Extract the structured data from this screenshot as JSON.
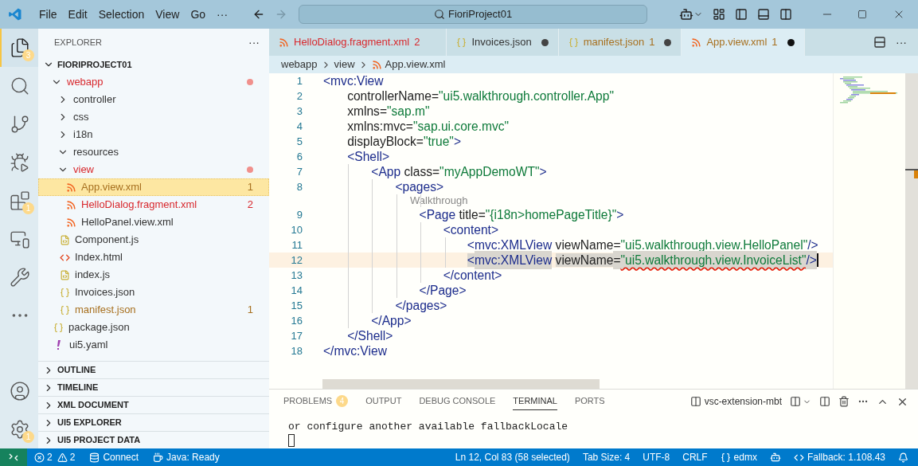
{
  "menu": [
    "File",
    "Edit",
    "Selection",
    "View",
    "Go",
    "···"
  ],
  "search": {
    "value": "FioriProject01"
  },
  "activity_bar": [
    {
      "kind": "explorer",
      "selected": true,
      "badge": "3"
    },
    {
      "kind": "search",
      "selected": false
    },
    {
      "kind": "source-control",
      "selected": false
    },
    {
      "kind": "run",
      "selected": false
    },
    {
      "kind": "extensions",
      "selected": false,
      "badge": "1"
    },
    {
      "kind": "remote",
      "selected": false
    },
    {
      "kind": "tools",
      "selected": false
    },
    {
      "kind": "more",
      "selected": false
    }
  ],
  "activity_bottom": [
    {
      "kind": "account"
    },
    {
      "kind": "settings",
      "badge": "1"
    }
  ],
  "explorer": {
    "title": "EXPLORER",
    "more": "···",
    "root": {
      "label": "FIORIPROJECT01",
      "expanded": true,
      "children": [
        {
          "label": "webapp",
          "kind": "folder",
          "expanded": true,
          "error": true,
          "warning": false,
          "selected": false,
          "children": [
            {
              "label": "controller",
              "kind": "folder",
              "expanded": false,
              "error": false,
              "warning": false,
              "selected": false
            },
            {
              "label": "css",
              "kind": "folder",
              "expanded": false,
              "error": false,
              "warning": false,
              "selected": false
            },
            {
              "label": "i18n",
              "kind": "folder",
              "expanded": false,
              "error": false,
              "warning": false,
              "selected": false
            },
            {
              "label": "resources",
              "kind": "folder",
              "expanded": true,
              "error": false,
              "warning": false,
              "selected": false
            },
            {
              "label": "view",
              "kind": "folder",
              "expanded": true,
              "error": true,
              "warning": false,
              "selected": false,
              "children": [
                {
                  "label": "App.view.xml",
                  "kind": "xml",
                  "error": false,
                  "warning": true,
                  "badge": "1",
                  "selected": true
                },
                {
                  "label": "HelloDialog.fragment.xml",
                  "kind": "xml",
                  "error": true,
                  "warning": false,
                  "badge": "2",
                  "selected": false
                },
                {
                  "label": "HelloPanel.view.xml",
                  "kind": "xml",
                  "error": false,
                  "warning": false,
                  "selected": false
                }
              ]
            },
            {
              "label": "Component.js",
              "kind": "js",
              "error": false,
              "warning": false,
              "selected": false
            },
            {
              "label": "Index.html",
              "kind": "html",
              "error": false,
              "warning": false,
              "selected": false
            },
            {
              "label": "index.js",
              "kind": "js",
              "error": false,
              "warning": false,
              "selected": false
            },
            {
              "label": "Invoices.json",
              "kind": "json",
              "error": false,
              "warning": false,
              "selected": false
            },
            {
              "label": "manifest.json",
              "kind": "json",
              "error": false,
              "warning": true,
              "badge": "1",
              "selected": false
            }
          ]
        },
        {
          "label": "package.json",
          "kind": "json",
          "error": false,
          "warning": false,
          "selected": false
        },
        {
          "label": "ui5.yaml",
          "kind": "yaml",
          "error": false,
          "warning": false,
          "selected": false
        }
      ]
    },
    "sections": [
      {
        "label": "OUTLINE",
        "expanded": false
      },
      {
        "label": "TIMELINE",
        "expanded": false
      },
      {
        "label": "XML DOCUMENT",
        "expanded": false
      },
      {
        "label": "UI5 EXPLORER",
        "expanded": false
      },
      {
        "label": "UI5 PROJECT DATA",
        "expanded": false
      }
    ]
  },
  "tabs": [
    {
      "label": "HelloDialog.fragment.xml",
      "kind": "xml",
      "error": true,
      "warning": false,
      "badge": "2",
      "modified": false,
      "selected": false
    },
    {
      "label": "Invoices.json",
      "kind": "json",
      "error": false,
      "warning": false,
      "modified": true,
      "selected": false
    },
    {
      "label": "manifest.json",
      "kind": "json",
      "error": false,
      "warning": true,
      "badge": "1",
      "modified": true,
      "selected": false
    },
    {
      "label": "App.view.xml",
      "kind": "xml",
      "error": false,
      "warning": true,
      "badge": "1",
      "modified": true,
      "selected": true
    }
  ],
  "tabs_more": "···",
  "breadcrumb": [
    {
      "label": "webapp",
      "kind": "folder"
    },
    {
      "label": "view",
      "kind": "folder"
    },
    {
      "label": "App.view.xml",
      "kind": "xml"
    }
  ],
  "code": [
    {
      "kind": "code",
      "number": "1",
      "tokens": [
        {
          "text": "<",
          "kind": "bracket"
        },
        {
          "text": "mvc:View",
          "kind": "tag"
        }
      ]
    },
    {
      "kind": "code",
      "number": "2",
      "tokens": [
        {
          "text": "    controllerName",
          "kind": "attr"
        },
        {
          "text": "=",
          "kind": "punct"
        },
        {
          "text": "\"ui5.walkthrough.controller.App\"",
          "kind": "string"
        }
      ]
    },
    {
      "kind": "code",
      "number": "3",
      "tokens": [
        {
          "text": "    xmlns",
          "kind": "attr"
        },
        {
          "text": "=",
          "kind": "punct"
        },
        {
          "text": "\"sap.m\"",
          "kind": "string"
        }
      ]
    },
    {
      "kind": "code",
      "number": "4",
      "tokens": [
        {
          "text": "    xmlns:mvc",
          "kind": "attr"
        },
        {
          "text": "=",
          "kind": "punct"
        },
        {
          "text": "\"sap.ui.core.mvc\"",
          "kind": "string"
        }
      ]
    },
    {
      "kind": "code",
      "number": "5",
      "tokens": [
        {
          "text": "    displayBlock",
          "kind": "attr"
        },
        {
          "text": "=",
          "kind": "punct"
        },
        {
          "text": "\"true\"",
          "kind": "string"
        },
        {
          "text": ">",
          "kind": "bracket"
        }
      ]
    },
    {
      "kind": "code",
      "number": "6",
      "tokens": [
        {
          "text": "    <",
          "kind": "bracket"
        },
        {
          "text": "Shell",
          "kind": "tag"
        },
        {
          "text": ">",
          "kind": "bracket"
        }
      ]
    },
    {
      "kind": "code",
      "number": "7",
      "tokens": [
        {
          "text": "        <",
          "kind": "bracket"
        },
        {
          "text": "App",
          "kind": "tag"
        },
        {
          "text": " class",
          "kind": "attr"
        },
        {
          "text": "=",
          "kind": "punct"
        },
        {
          "text": "\"myAppDemoWT\"",
          "kind": "string"
        },
        {
          "text": ">",
          "kind": "bracket"
        }
      ]
    },
    {
      "kind": "code",
      "number": "8",
      "tokens": [
        {
          "text": "            <",
          "kind": "bracket"
        },
        {
          "text": "pages",
          "kind": "tag"
        },
        {
          "text": ">",
          "kind": "bracket"
        }
      ]
    },
    {
      "kind": "codelens",
      "tokens": [
        {
          "text": "                Walkthrough",
          "kind": "hint"
        }
      ]
    },
    {
      "kind": "code",
      "number": "9",
      "tokens": [
        {
          "text": "                <",
          "kind": "bracket"
        },
        {
          "text": "Page",
          "kind": "tag"
        },
        {
          "text": " title",
          "kind": "attr"
        },
        {
          "text": "=",
          "kind": "punct"
        },
        {
          "text": "\"{i18n>homePageTitle}\"",
          "kind": "string"
        },
        {
          "text": ">",
          "kind": "bracket"
        }
      ]
    },
    {
      "kind": "code",
      "number": "10",
      "tokens": [
        {
          "text": "                    <",
          "kind": "bracket"
        },
        {
          "text": "content",
          "kind": "tag"
        },
        {
          "text": ">",
          "kind": "bracket"
        }
      ]
    },
    {
      "kind": "code",
      "number": "11",
      "tokens": [
        {
          "text": "                        <",
          "kind": "bracket"
        },
        {
          "text": "mvc:XMLView",
          "kind": "tag"
        },
        {
          "text": " viewName",
          "kind": "attr"
        },
        {
          "text": "=",
          "kind": "punct"
        },
        {
          "text": "\"ui5.walkthrough.view.HelloPanel\"",
          "kind": "string"
        },
        {
          "text": "/>",
          "kind": "bracket"
        }
      ]
    },
    {
      "kind": "code",
      "number": "12",
      "current": true,
      "tokens": [
        {
          "text": "                        <",
          "kind": "bracket",
          "selected": true
        },
        {
          "text": "mvc:XMLView",
          "kind": "tag",
          "selected": true
        },
        {
          "text": " viewName",
          "kind": "attr",
          "selected": true
        },
        {
          "text": "=",
          "kind": "punct",
          "selected": true
        },
        {
          "text": "\"ui5.walkthrough.view.InvoiceList\"",
          "kind": "string",
          "selected": true,
          "error": true
        },
        {
          "text": "/>",
          "kind": "bracket",
          "selected": true
        }
      ]
    },
    {
      "kind": "code",
      "number": "13",
      "tokens": [
        {
          "text": "                    </",
          "kind": "bracket"
        },
        {
          "text": "content",
          "kind": "tag"
        },
        {
          "text": ">",
          "kind": "bracket"
        }
      ]
    },
    {
      "kind": "code",
      "number": "14",
      "tokens": [
        {
          "text": "                </",
          "kind": "bracket"
        },
        {
          "text": "Page",
          "kind": "tag"
        },
        {
          "text": ">",
          "kind": "bracket"
        }
      ]
    },
    {
      "kind": "code",
      "number": "15",
      "tokens": [
        {
          "text": "            </",
          "kind": "bracket"
        },
        {
          "text": "pages",
          "kind": "tag"
        },
        {
          "text": ">",
          "kind": "bracket"
        }
      ]
    },
    {
      "kind": "code",
      "number": "16",
      "tokens": [
        {
          "text": "        </",
          "kind": "bracket"
        },
        {
          "text": "App",
          "kind": "tag"
        },
        {
          "text": ">",
          "kind": "bracket"
        }
      ]
    },
    {
      "kind": "code",
      "number": "17",
      "tokens": [
        {
          "text": "    </",
          "kind": "bracket"
        },
        {
          "text": "Shell",
          "kind": "tag"
        },
        {
          "text": ">",
          "kind": "bracket"
        }
      ]
    },
    {
      "kind": "code",
      "number": "18",
      "tokens": [
        {
          "text": "</",
          "kind": "bracket"
        },
        {
          "text": "mvc:View",
          "kind": "tag"
        }
      ]
    }
  ],
  "panel": {
    "tabs": [
      {
        "label": "PROBLEMS",
        "badge": "4",
        "selected": false
      },
      {
        "label": "OUTPUT",
        "selected": false
      },
      {
        "label": "DEBUG CONSOLE",
        "selected": false
      },
      {
        "label": "TERMINAL",
        "selected": true
      },
      {
        "label": "PORTS",
        "selected": false
      }
    ],
    "terminal_name": "vsc-extension-mbt",
    "terminal_lines": [
      "or configure another available fallbackLocale"
    ]
  },
  "status_bar": {
    "errors": "2",
    "warnings": "2",
    "connect": "Connect",
    "java": "Java: Ready",
    "right": [
      {
        "kind": "text",
        "text": "Ln 12, Col 83 (58 selected)"
      },
      {
        "kind": "text",
        "text": "Tab Size: 4"
      },
      {
        "kind": "text",
        "text": "UTF-8"
      },
      {
        "kind": "text",
        "text": "CRLF"
      },
      {
        "kind": "braces",
        "text": "edmx"
      },
      {
        "kind": "copilot"
      },
      {
        "kind": "code",
        "text": "Fallback: 1.108.43"
      },
      {
        "kind": "bell"
      }
    ]
  }
}
